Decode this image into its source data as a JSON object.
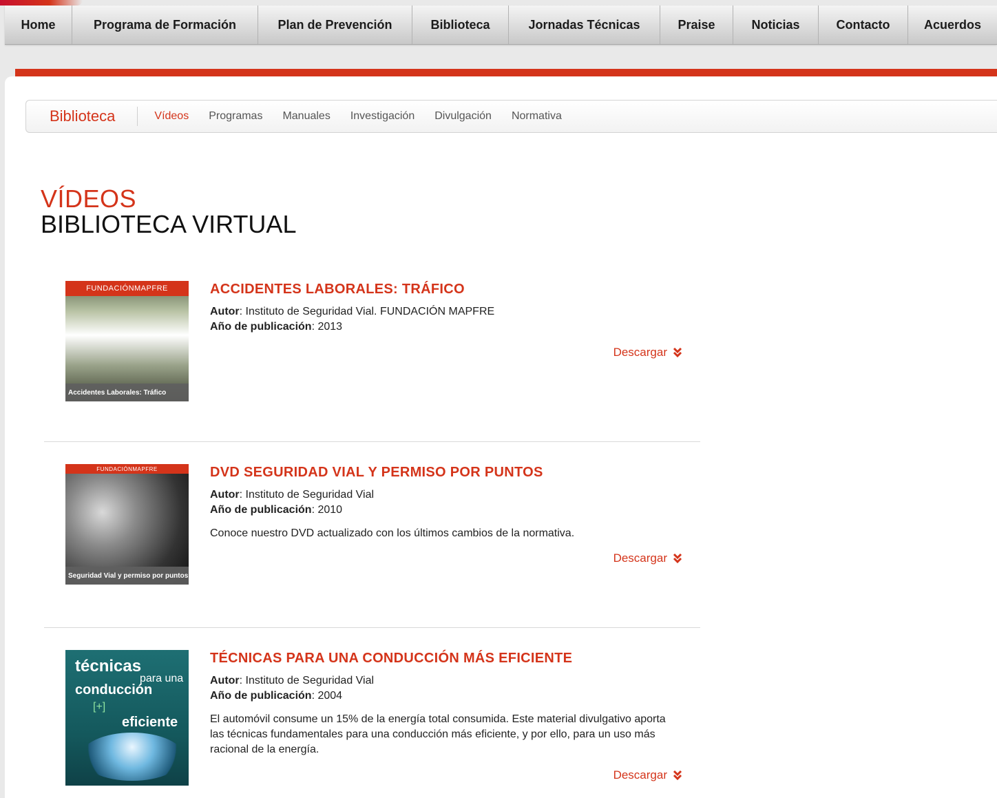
{
  "nav": {
    "items": [
      {
        "label": "Home"
      },
      {
        "label": "Programa de Formación"
      },
      {
        "label": "Plan de Prevención"
      },
      {
        "label": "Biblioteca"
      },
      {
        "label": "Jornadas Técnicas"
      },
      {
        "label": "Praise"
      },
      {
        "label": "Noticias"
      },
      {
        "label": "Contacto"
      },
      {
        "label": "Acuerdos"
      }
    ]
  },
  "subnav": {
    "title": "Biblioteca",
    "links": [
      {
        "label": "Vídeos",
        "active": true
      },
      {
        "label": "Programas"
      },
      {
        "label": "Manuales"
      },
      {
        "label": "Investigación"
      },
      {
        "label": "Divulgación"
      },
      {
        "label": "Normativa"
      }
    ]
  },
  "page": {
    "heading_red": "VÍDEOS",
    "heading_black": "BIBLIOTECA VIRTUAL"
  },
  "labels": {
    "author": "Autor",
    "year": "Año de publicación",
    "download": "Descargar"
  },
  "entries": [
    {
      "title": "ACCIDENTES LABORALES: TRÁFICO",
      "author": ": Instituto de Seguridad Vial. FUNDACIÓN MAPFRE",
      "year": ": 2013",
      "description": "",
      "thumb_brand": "FUNDACIÓNMAPFRE",
      "thumb_caption": "Accidentes Laborales: Tráfico"
    },
    {
      "title": "DVD SEGURIDAD VIAL Y PERMISO POR PUNTOS",
      "author": ": Instituto de Seguridad Vial",
      "year": ": 2010",
      "description": "Conoce nuestro DVD actualizado con los últimos cambios de la normativa.",
      "thumb_brand": "FUNDACIÓNMAPFRE",
      "thumb_caption": "Seguridad Vial y permiso por puntos"
    },
    {
      "title": "TÉCNICAS PARA UNA CONDUCCIÓN MÁS EFICIENTE",
      "author": ": Instituto de Seguridad Vial",
      "year": ": 2004",
      "description": "El automóvil consume un 15% de la energía total consumida. Este material divulgativo aporta las técnicas fundamentales para una conducción más eficiente, y por ello, para un uso más racional de la energía.",
      "thumb_text": [
        "técnicas",
        "para una",
        "conducción",
        "[+]",
        "eficiente"
      ]
    }
  ],
  "colors": {
    "accent": "#d4341a",
    "nav_text": "#1b1b1b",
    "subnav_text": "#555555"
  }
}
